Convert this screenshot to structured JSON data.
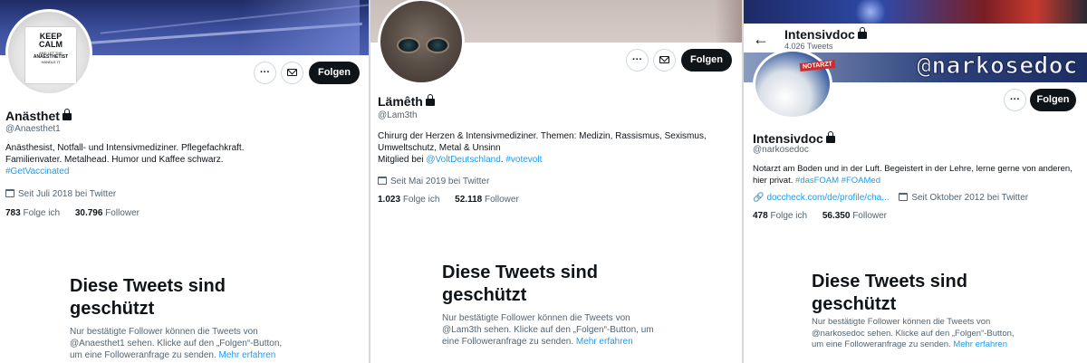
{
  "profiles": [
    {
      "display_name": "Anästhet",
      "handle": "@Anaesthet1",
      "bio_line1": "Anästhesist, Notfall- und Intensivmediziner. Pflegefachkraft.",
      "bio_line2": "Familienvater. Metalhead. Humor und Kaffee schwarz.",
      "hashtag": "#GetVaccinated",
      "joined": "Seit Juli 2018 bei Twitter",
      "following_count": "783",
      "following_label": "Folge ich",
      "followers_count": "30.796",
      "followers_label": "Follower",
      "follow_button": "Folgen",
      "more_button": "···",
      "avatar_mug_lines": [
        "KEEP",
        "CALM",
        "AND LET THE",
        "ANAESTHETIST",
        "HANDLE IT"
      ],
      "protected_title_1": "Diese Tweets sind",
      "protected_title_2": "geschützt",
      "protected_text_1": "Nur bestätigte Follower können die Tweets von",
      "protected_text_2": "@Anaesthet1 sehen. Klicke auf den „Folgen“-Button,",
      "protected_text_3": "um eine Followeranfrage zu senden.",
      "learn_more": "Mehr erfahren"
    },
    {
      "display_name": "Lämêth",
      "handle": "@Lam3th",
      "bio_line1": "Chirurg der Herzen & Intensivmediziner. Themen: Medizin, Rassismus, Sexismus,",
      "bio_line2": "Umweltschutz, Metal & Unsinn",
      "bio_line3_prefix": "Mitglied bei ",
      "bio_mention": "@VoltDeutschland",
      "bio_sep": ". ",
      "hashtag": "#votevolt",
      "joined": "Seit Mai 2019 bei Twitter",
      "following_count": "1.023",
      "following_label": "Folge ich",
      "followers_count": "52.118",
      "followers_label": "Follower",
      "follow_button": "Folgen",
      "more_button": "···",
      "protected_title_1": "Diese Tweets sind",
      "protected_title_2": "geschützt",
      "protected_text_1": "Nur bestätigte Follower können die Tweets von",
      "protected_text_2": "@Lam3th sehen. Klicke auf den „Folgen“-Button, um",
      "protected_text_3": "eine Followeranfrage zu senden.",
      "learn_more": "Mehr erfahren"
    },
    {
      "header_name": "Intensivdoc",
      "header_tweets": "4.026 Tweets",
      "banner_text": "@narkosedoc",
      "avatar_badge": "NOTARZT",
      "display_name": "Intensivdoc",
      "handle": "@narkosedoc",
      "bio_line1": "Notarzt am Boden und in der Luft. Begeistert in der Lehre, lerne gerne von anderen,",
      "bio_line2_prefix": "hier privat. ",
      "hashtags": "#dasFOAM #FOAMed",
      "website": "doccheck.com/de/profile/cha...",
      "joined": "Seit Oktober 2012 bei Twitter",
      "following_count": "478",
      "following_label": "Folge ich",
      "followers_count": "56.350",
      "followers_label": "Follower",
      "follow_button": "Folgen",
      "more_button": "···",
      "protected_title_1": "Diese Tweets sind",
      "protected_title_2": "geschützt",
      "protected_text_1": "Nur bestätigte Follower können die Tweets von",
      "protected_text_2": "@narkosedoc sehen. Klicke auf den „Folgen“-Button,",
      "protected_text_3": "um eine Followeranfrage zu senden.",
      "learn_more": "Mehr erfahren"
    }
  ],
  "icons": {
    "back": "←",
    "website_link": "🔗"
  }
}
